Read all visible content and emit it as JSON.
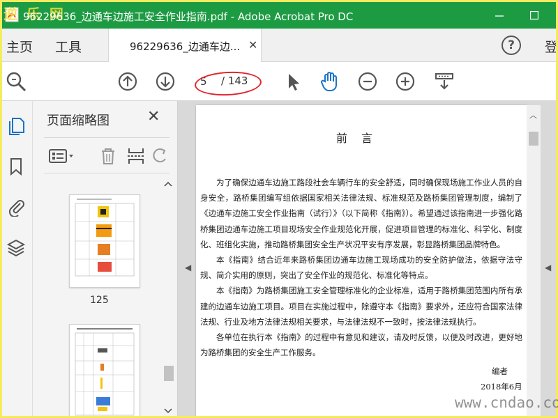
{
  "window": {
    "title": "96229636_边通车边施工安全作业指南.pdf - Adobe Acrobat Pro DC",
    "watermark_top_left": "逆 乐 网",
    "title_color": "#1d9b43"
  },
  "menubar": {
    "home": "主页",
    "tools": "工具",
    "doc_tab": "96229636_边通车边...",
    "help": "?",
    "signin": "登"
  },
  "toolbar": {
    "current_page": "5",
    "total_pages": "/ 143"
  },
  "thumbnails": {
    "title": "页面缩略图",
    "close": "✕",
    "items": [
      {
        "label": "125"
      },
      {
        "label": ""
      }
    ]
  },
  "document": {
    "heading": "前言",
    "paragraphs": [
      "为了确保边通车边施工路段社会车辆行车的安全舒适，同时确保现场施工作业人员的自身安全，路桥集团编写组依据国家相关法律法规、标准规范及路桥集团管理制度，编制了《边通车边施工安全作业指南（试行）》（以下简称《指南》）。希望通过该指南进一步强化路桥集团边通车边施工项目现场安全作业规范化开展，促进项目管理的标准化、科学化、制度化、班组化实施，推动路桥集团安全生产状况平安有序发展，彰显路桥集团品牌特色。",
      "本《指南》结合近年来路桥集团边通车边施工现场成功的安全防护做法，依据守法守规、简介实用的原则，突出了安全作业的规范化、标准化等特点。",
      "本《指南》为路桥集团施工安全管理标准化的企业标准，适用于路桥集团范围内所有承建的边通车边施工项目。项目在实施过程中，除遵守本《指南》要求外，还应符合国家法律法规、行业及地方法律法规相关要求，与法律法规不一致时，按法律法规执行。",
      "各单位在执行本《指南》的过程中有意见和建议，请及时反馈，以便及时改进，更好地为路桥集团的安全生产工作服务。"
    ],
    "sign": "编者",
    "date": "2018年6月"
  },
  "watermark_bottom_right": "www.cndao.com"
}
